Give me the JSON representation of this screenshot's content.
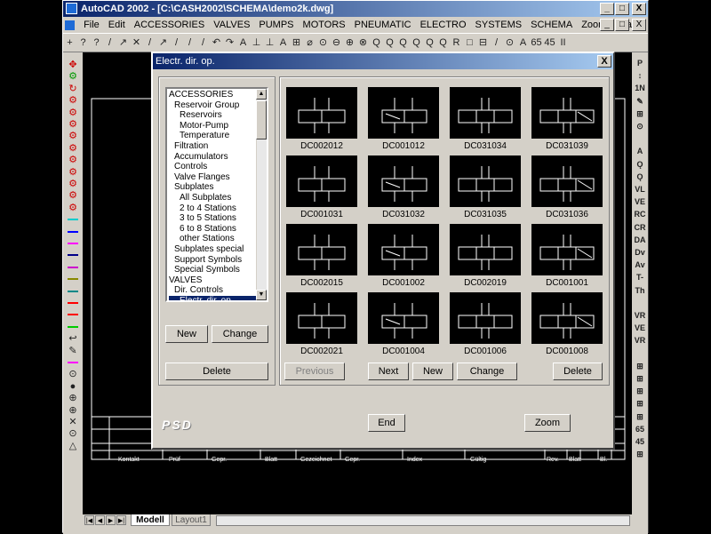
{
  "app": {
    "title": "AutoCAD 2002 - [C:\\CASH2002\\SCHEMA\\demo2k.dwg]",
    "window_buttons": [
      "_",
      "□",
      "X"
    ],
    "doc_buttons": [
      "_",
      "□",
      "X"
    ]
  },
  "menu": [
    "File",
    "Edit",
    "ACCESSORIES",
    "VALVES",
    "PUMPS",
    "MOTORS",
    "PNEUMATIC",
    "ELECTRO",
    "SYSTEMS",
    "SCHEMA",
    "Zoom / Snap"
  ],
  "toolbar_icons": [
    "+",
    "?",
    "?",
    "/",
    "↗",
    "✕",
    "/",
    "↗",
    "/",
    "/",
    "/",
    "↶",
    "↷",
    "A",
    "⊥",
    "⊥",
    "A",
    "⊞",
    "⌀",
    "⊙",
    "⊖",
    "⊕",
    "⊗",
    "Q",
    "Q",
    "Q",
    "Q",
    "Q",
    "Q",
    "R",
    "□",
    "⊟",
    "/",
    "⊙",
    "A",
    "65",
    "45",
    "II"
  ],
  "left_tools": [
    "✥",
    "⚙",
    "↻",
    "⚙",
    "⚙",
    "⚙",
    "⚙",
    "⚙",
    "⚙",
    "⚙",
    "⚙",
    "⚙",
    "⚙",
    "",
    "",
    "",
    "",
    "",
    "",
    "",
    "",
    "",
    "",
    "↩",
    "✎",
    "",
    "⊙",
    "●",
    "⊕",
    "⊕",
    "✕",
    "⊙",
    "△"
  ],
  "right_tools": [
    "P",
    "↕",
    "1N",
    "✎",
    "⊞",
    "⊙",
    "",
    "A",
    "Ǫ",
    "Ǫ",
    "VL",
    "VE",
    "RC",
    "CR",
    "DA",
    "Dv",
    "Av",
    "T-",
    "Th",
    "",
    "VR",
    "VE",
    "VR",
    "",
    "⊞",
    "⊞",
    "⊞",
    "⊞",
    "⊞",
    "65",
    "45",
    "⊞"
  ],
  "dialog": {
    "title": "Electr. dir. op.",
    "close": "X",
    "tree": [
      {
        "label": "ACCESSORIES",
        "level": 0
      },
      {
        "label": "Reservoir Group",
        "level": 1
      },
      {
        "label": "Reservoirs",
        "level": 2
      },
      {
        "label": "Motor-Pump",
        "level": 2
      },
      {
        "label": "Temperature",
        "level": 2
      },
      {
        "label": "Filtration",
        "level": 1
      },
      {
        "label": "Accumulators",
        "level": 1
      },
      {
        "label": "Controls",
        "level": 1
      },
      {
        "label": "Valve Flanges",
        "level": 1
      },
      {
        "label": "Subplates",
        "level": 1
      },
      {
        "label": "All Subplates",
        "level": 2
      },
      {
        "label": "2 to 4 Stations",
        "level": 2
      },
      {
        "label": "3 to 5 Stations",
        "level": 2
      },
      {
        "label": "6 to 8 Stations",
        "level": 2
      },
      {
        "label": "other Stations",
        "level": 2
      },
      {
        "label": "Subplates special",
        "level": 1
      },
      {
        "label": "Support Symbols",
        "level": 1
      },
      {
        "label": "Special Symbols",
        "level": 1
      },
      {
        "label": "VALVES",
        "level": 0
      },
      {
        "label": "Dir. Controls",
        "level": 1
      },
      {
        "label": "Electr. dir. op.",
        "level": 2,
        "selected": true
      }
    ],
    "tree_buttons": {
      "new": "New",
      "change": "Change",
      "delete": "Delete"
    },
    "symbols": [
      "DC002012",
      "DC001012",
      "DC031034",
      "DC031039",
      "DC001031",
      "DC031032",
      "DC031035",
      "DC031036",
      "DC002015",
      "DC001002",
      "DC002019",
      "DC001001",
      "DC002021",
      "DC001004",
      "DC001006",
      "DC001008"
    ],
    "grid_buttons": {
      "previous": "Previous",
      "next": "Next",
      "new": "New",
      "change": "Change",
      "delete": "Delete"
    },
    "logo": "PSD",
    "end": "End",
    "zoom": "Zoom"
  },
  "title_block": {
    "cells": [
      "Kontakt",
      "Prüf",
      "Gepr.",
      "Blatt",
      "Gezeichnet",
      "Gepr.",
      "Index",
      "Gültig",
      "Rev.",
      "Blatt",
      "Bl."
    ]
  },
  "tabs": {
    "buttons": [
      "|◀",
      "◀",
      "▶",
      "▶|"
    ],
    "items": [
      "Modell",
      "Layout1"
    ]
  }
}
